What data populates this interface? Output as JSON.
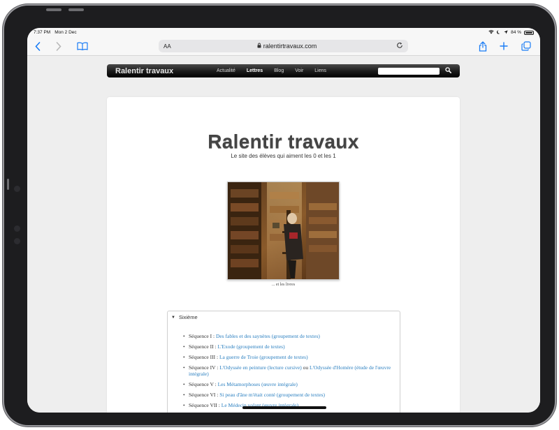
{
  "status_bar": {
    "time": "7:37 PM",
    "date": "Mon 2 Dec",
    "battery": "84 %",
    "battery_level": 0.84
  },
  "browser": {
    "text_size_label": "AA",
    "domain": "ralentirtravaux.com"
  },
  "site_nav": {
    "brand": "Ralentir travaux",
    "links": [
      "Actualité",
      "Lettres",
      "Blog",
      "Voir",
      "Liens"
    ],
    "active": "Lettres"
  },
  "header": {
    "title": "Ralentir travaux",
    "subtitle": "Le site des élèves qui aiment les 0 et les 1"
  },
  "figure": {
    "caption": "... et les livres"
  },
  "accordion": {
    "title": "Sixième",
    "items": [
      {
        "prefix": "Séquence I : ",
        "link": "Des fables et des saynètes (groupement de textes)"
      },
      {
        "prefix": "Séquence II : ",
        "link": "L'Exode (groupement de textes)"
      },
      {
        "prefix": "Séquence III : ",
        "link": "La guerre de Troie (groupement de textes)"
      },
      {
        "prefix": "Séquence IV : ",
        "link": "L'Odyssée en peinture (lecture cursive)",
        "middle": " ou ",
        "link2": "L'Odyssée d'Homère (étude de l'œuvre intégrale)"
      },
      {
        "prefix": "Séquence V : ",
        "link": "Les Métamorphoses (œuvre intégrale)"
      },
      {
        "prefix": "Séquence VI : ",
        "link": "Si peau d'âne m'était conté (groupement de textes)"
      },
      {
        "prefix": "Séquence VII : ",
        "link": "Le Médecin volant (œuvre intégrale)"
      }
    ]
  }
}
